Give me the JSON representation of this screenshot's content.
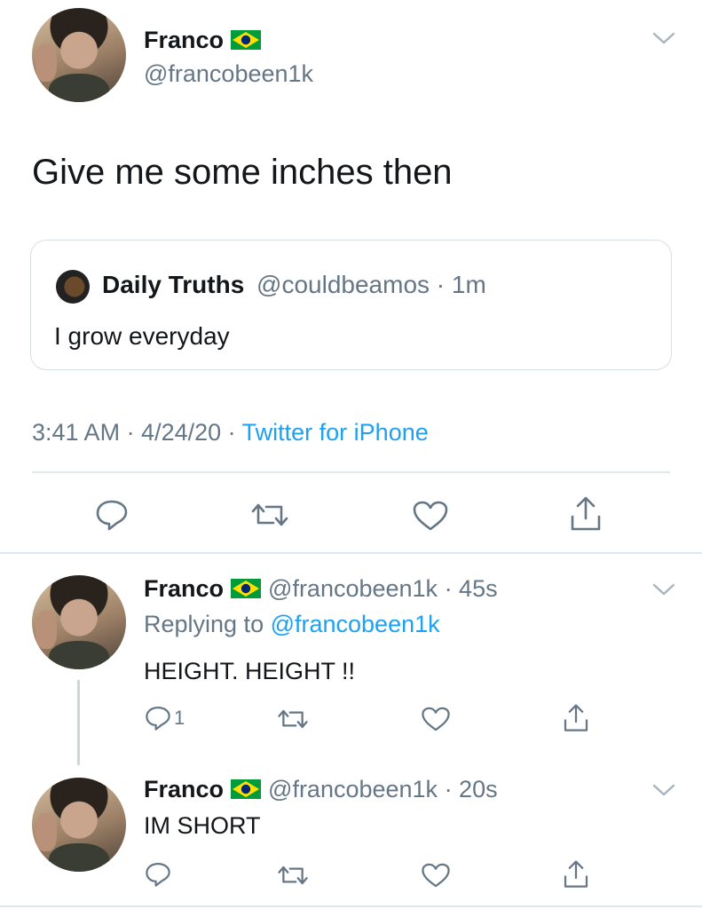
{
  "main_tweet": {
    "author_name": "Franco",
    "handle": "@francobeen1k",
    "text": "Give me some inches then",
    "timestamp": "3:41 AM · 4/24/20 · ",
    "source": "Twitter for iPhone"
  },
  "quoted_tweet": {
    "author_name": "Daily Truths",
    "handle_time": "@couldbeamos · 1m",
    "text": "I grow everyday"
  },
  "reply1": {
    "author_name": "Franco",
    "handle_time": "@francobeen1k · 45s",
    "replying_prefix": "Replying to ",
    "replying_handle": "@francobeen1k",
    "text": "HEIGHT. HEIGHT !!",
    "reply_count": "1"
  },
  "reply2": {
    "author_name": "Franco",
    "handle_time": "@francobeen1k · 20s",
    "text": "IM SHORT"
  },
  "icons": {
    "reply": "reply-icon",
    "retweet": "retweet-icon",
    "like": "heart-icon",
    "share": "share-icon",
    "more": "chevron-down-icon",
    "flag": "brazil-flag-icon"
  },
  "colors": {
    "link": "#1da1f2",
    "secondary_text": "#657786",
    "icon": "#657786",
    "border": "#e1e8ed"
  }
}
